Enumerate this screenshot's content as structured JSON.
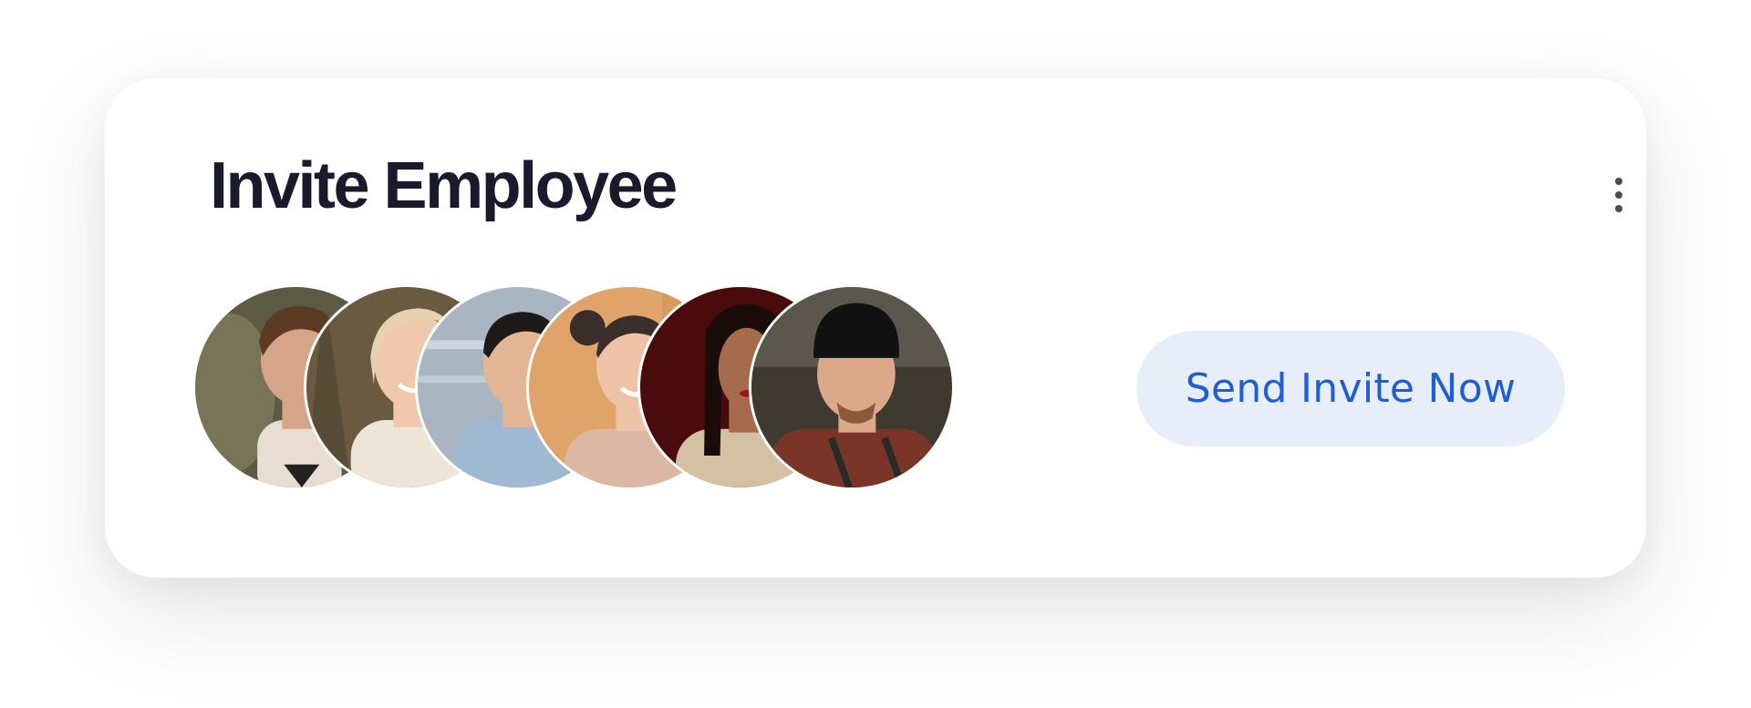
{
  "card": {
    "title": "Invite Employee",
    "more_menu_icon": "more-vertical-icon",
    "send_button_label": "Send Invite Now"
  },
  "avatars": [
    {
      "id": "employee-1",
      "bg": "#5d5a44",
      "skin": "#d6a488",
      "hair": "#5b3b24",
      "shirt": "#e8ddd0"
    },
    {
      "id": "employee-2",
      "bg": "#6a5a40",
      "skin": "#f0c8ae",
      "hair": "#e6d2b0",
      "shirt": "#efe4d8"
    },
    {
      "id": "employee-3",
      "bg": "#a9b6c2",
      "skin": "#e2b694",
      "hair": "#1d1a18",
      "shirt": "#9fb9d2"
    },
    {
      "id": "employee-4",
      "bg": "#e0a36a",
      "skin": "#efc3a8",
      "hair": "#3a2e2a",
      "shirt": "#dcb8a4"
    },
    {
      "id": "employee-5",
      "bg": "#4a0b0c",
      "skin": "#a66a4c",
      "hair": "#1a0c0a",
      "shirt": "#d4c1a4"
    },
    {
      "id": "employee-6",
      "bg": "#3f3a2f",
      "skin": "#dba98a",
      "hair": "#111111",
      "shirt": "#7a3528"
    }
  ],
  "colors": {
    "title": "#191a2b",
    "button_bg": "#e8eef9",
    "button_text": "#1f5fd1",
    "menu_dots": "#4a4b55"
  }
}
